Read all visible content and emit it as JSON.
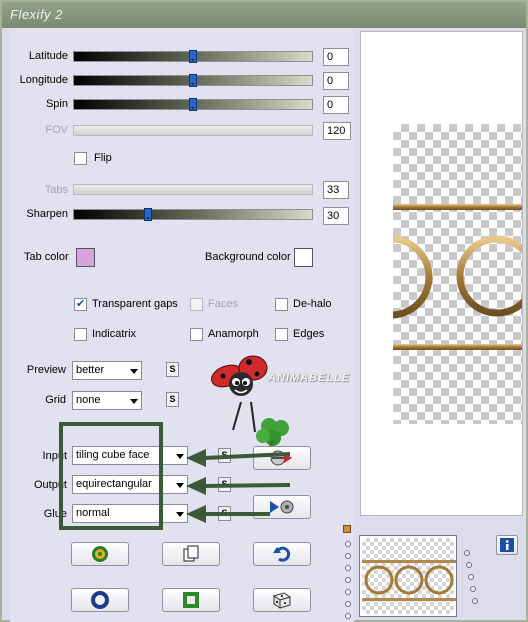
{
  "window": {
    "title": "Flexify 2"
  },
  "sliders": {
    "latitude": {
      "label": "Latitude",
      "value": "0",
      "position": 0.5
    },
    "longitude": {
      "label": "Longitude",
      "value": "0",
      "position": 0.5
    },
    "spin": {
      "label": "Spin",
      "value": "0",
      "position": 0.5
    },
    "fov": {
      "label": "FOV",
      "value": "120"
    },
    "tabs": {
      "label": "Tabs",
      "value": "33"
    },
    "sharpen": {
      "label": "Sharpen",
      "value": "30",
      "position": 0.3
    }
  },
  "flip": {
    "label": "Flip",
    "checked": false
  },
  "colors": {
    "tab_color_label": "Tab color",
    "tab_color": "#d7a4dc",
    "background_color_label": "Background color",
    "background_color": "#ffffff"
  },
  "options": {
    "transparent_gaps": {
      "label": "Transparent gaps",
      "checked": true
    },
    "faces": {
      "label": "Faces",
      "checked": false,
      "disabled": true
    },
    "de_halo": {
      "label": "De-halo",
      "checked": false
    },
    "indicatrix": {
      "label": "Indicatrix",
      "checked": false
    },
    "anamorph": {
      "label": "Anamorph",
      "checked": false
    },
    "edges": {
      "label": "Edges",
      "checked": false
    }
  },
  "preview": {
    "label": "Preview",
    "value": "better"
  },
  "grid": {
    "label": "Grid",
    "value": "none"
  },
  "input": {
    "label": "Input",
    "value": "tiling cube face"
  },
  "output": {
    "label": "Output",
    "value": "equirectangular"
  },
  "glue": {
    "label": "Glue",
    "value": "normal"
  },
  "s_button_label": "S",
  "watermark": "ANIMABELLE",
  "accent_colors": {
    "slider_thumb": "#2b69c8",
    "annotation_green": "#3b5a37",
    "ring_gold": "#b08a4c"
  },
  "icons": [
    "swap-direction-icon",
    "transport-arrows-icon",
    "settings-gear-icon",
    "copy-page-icon",
    "undo-arrow-icon",
    "ring-icon",
    "square-frame-icon",
    "dice-icon",
    "info-icon"
  ]
}
